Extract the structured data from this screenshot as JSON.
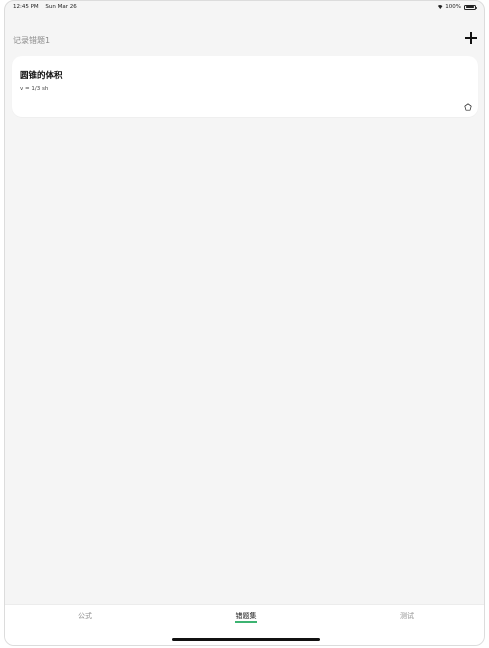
{
  "status_bar": {
    "time": "12:45 PM",
    "date": "Sun Mar 26",
    "battery": "100%"
  },
  "nav": {
    "title": "记录错题1",
    "add_icon": "plus-icon"
  },
  "cards": [
    {
      "title": "圆锥的体积",
      "formula": "v = 1/3 sh",
      "icon": "pentagon-outline-icon"
    }
  ],
  "tabs": [
    {
      "label": "公式",
      "active": false
    },
    {
      "label": "错题集",
      "active": true
    },
    {
      "label": "测试",
      "active": false
    }
  ],
  "colors": {
    "accent": "#3cb371",
    "background": "#f5f5f5",
    "card": "#ffffff"
  }
}
